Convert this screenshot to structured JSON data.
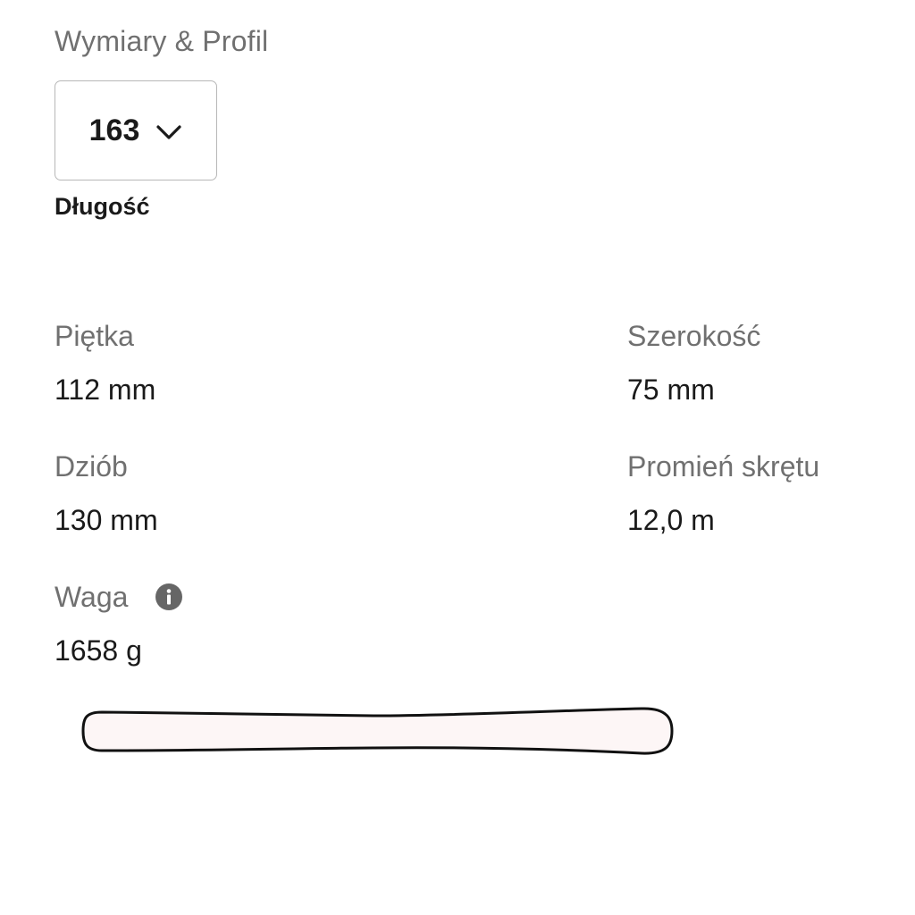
{
  "section": {
    "title": "Wymiary & Profil"
  },
  "length_selector": {
    "value": "163",
    "caption": "Długość",
    "icon": "chevron-down-icon"
  },
  "specs": {
    "tail": {
      "label": "Piętka",
      "value": "112 mm"
    },
    "width": {
      "label": "Szerokość",
      "value": "75 mm"
    },
    "tip": {
      "label": "Dziób",
      "value": "130 mm"
    },
    "radius": {
      "label": "Promień skrętu",
      "value": "12,0 m"
    },
    "weight": {
      "label": "Waga",
      "value": "1658 g",
      "icon": "info-icon"
    }
  },
  "colors": {
    "label": "#707070",
    "value": "#1a1a1a",
    "ski_fill": "#fdf6f6",
    "ski_outline": "#111111"
  }
}
